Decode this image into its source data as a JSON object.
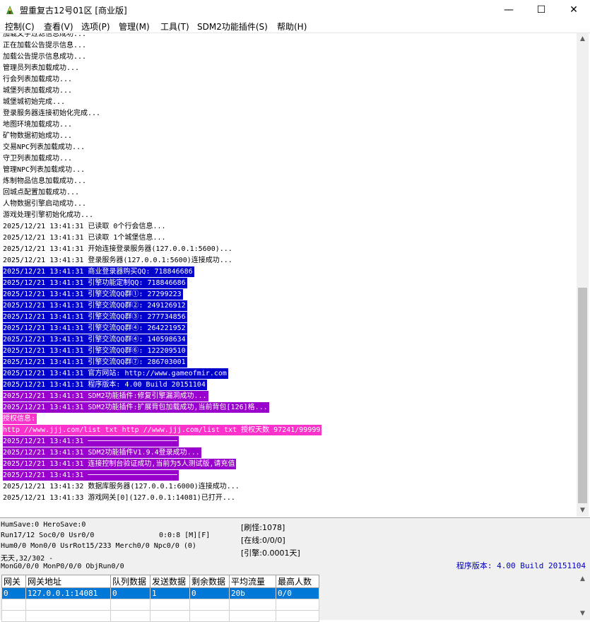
{
  "window": {
    "title": "盟重复古12号01区 [商业版]",
    "minimize": "—",
    "maximize": "☐",
    "close": "✕"
  },
  "menu": [
    "控制(C)",
    "查看(V)",
    "选项(P)",
    "管理(M)",
    "工具(T)",
    "SDM2功能插件(S)",
    "帮助(H)"
  ],
  "log": [
    {
      "text": "加载文字过滤信息成功...",
      "bg": "",
      "fg": "#000000"
    },
    {
      "text": "正在加载公告提示信息...",
      "bg": "",
      "fg": "#000000"
    },
    {
      "text": "加载公告提示信息成功...",
      "bg": "",
      "fg": "#000000"
    },
    {
      "text": "管理员列表加载成功...",
      "bg": "",
      "fg": "#000000"
    },
    {
      "text": "行会列表加载成功...",
      "bg": "",
      "fg": "#000000"
    },
    {
      "text": "城堡列表加载成功...",
      "bg": "",
      "fg": "#000000"
    },
    {
      "text": "城堡城初始完成...",
      "bg": "",
      "fg": "#000000"
    },
    {
      "text": "登录服务器连接初始化完成...",
      "bg": "",
      "fg": "#000000"
    },
    {
      "text": "地图环境加载成功...",
      "bg": "",
      "fg": "#000000"
    },
    {
      "text": "矿物数据初始成功...",
      "bg": "",
      "fg": "#000000"
    },
    {
      "text": "交易NPC列表加载成功...",
      "bg": "",
      "fg": "#000000"
    },
    {
      "text": "守卫列表加载成功...",
      "bg": "",
      "fg": "#000000"
    },
    {
      "text": "管理NPC列表加载成功...",
      "bg": "",
      "fg": "#000000"
    },
    {
      "text": "炼制物品信息加载成功...",
      "bg": "",
      "fg": "#000000"
    },
    {
      "text": "回城点配置加载成功...",
      "bg": "",
      "fg": "#000000"
    },
    {
      "text": "人物数据引擎启动成功...",
      "bg": "",
      "fg": "#000000"
    },
    {
      "text": "游戏处理引擎初始化成功...",
      "bg": "",
      "fg": "#000000"
    },
    {
      "text": "2025/12/21 13:41:31 已读取 0个行会信息...",
      "bg": "",
      "fg": "#000000"
    },
    {
      "text": "2025/12/21 13:41:31 已读取 1个城堡信息...",
      "bg": "",
      "fg": "#000000"
    },
    {
      "text": "2025/12/21 13:41:31 开始连接登录服务器(127.0.0.1:5600)...",
      "bg": "",
      "fg": "#000000"
    },
    {
      "text": "2025/12/21 13:41:31 登录服务器(127.0.0.1:5600)连接成功...",
      "bg": "",
      "fg": "#000000"
    },
    {
      "text": "2025/12/21 13:41:31 商业登录器购买QQ: 718846686",
      "bg": "#0000cc",
      "fg": "#ffffff"
    },
    {
      "text": "2025/12/21 13:41:31 引擎功能定制QQ: 718846686",
      "bg": "#0000cc",
      "fg": "#ffffff"
    },
    {
      "text": "2025/12/21 13:41:31 引擎交流QQ群①: 27299223",
      "bg": "#0000cc",
      "fg": "#ffffff"
    },
    {
      "text": "2025/12/21 13:41:31 引擎交流QQ群②: 249126912",
      "bg": "#0000cc",
      "fg": "#ffffff"
    },
    {
      "text": "2025/12/21 13:41:31 引擎交流QQ群③: 277734856",
      "bg": "#0000cc",
      "fg": "#ffffff"
    },
    {
      "text": "2025/12/21 13:41:31 引擎交流QQ群④: 264221952",
      "bg": "#0000cc",
      "fg": "#ffffff"
    },
    {
      "text": "2025/12/21 13:41:31 引擎交流QQ群④: 140598634",
      "bg": "#0000cc",
      "fg": "#ffffff"
    },
    {
      "text": "2025/12/21 13:41:31 引擎交流QQ群⑥: 122209510",
      "bg": "#0000cc",
      "fg": "#ffffff"
    },
    {
      "text": "2025/12/21 13:41:31 引擎交流QQ群⑦: 286703001",
      "bg": "#0000cc",
      "fg": "#ffffff"
    },
    {
      "text": "2025/12/21 13:41:31 官方网站: http://www.gameofmir.com",
      "bg": "#0000cc",
      "fg": "#ffffff"
    },
    {
      "text": "2025/12/21 13:41:31 程序版本: 4.00 Build 20151104",
      "bg": "#0000cc",
      "fg": "#ffffff"
    },
    {
      "text": "2025/12/21 13:41:31 SDM2功能插件:修复引擎漏洞成功...",
      "bg": "#9900cc",
      "fg": "#ffffff"
    },
    {
      "text": "2025/12/21 13:41:31 SDM2功能插件:扩展背包加载成功,当前背包[126]格...",
      "bg": "#9900cc",
      "fg": "#ffffff"
    },
    {
      "text": "授权信息:",
      "bg": "#ff33cc",
      "fg": "#ffffff"
    },
    {
      "text": "http //www.jjj.com/list txt http //www.jjj.com/list txt 授权天数 97241/99999",
      "bg": "#ff33cc",
      "fg": "#ffffff"
    },
    {
      "text": "2025/12/21 13:41:31 ─────────────────────",
      "bg": "#9900cc",
      "fg": "#ffffff"
    },
    {
      "text": "2025/12/21 13:41:31 SDM2功能插件V1.9.4登录成功...",
      "bg": "#9900cc",
      "fg": "#ffffff"
    },
    {
      "text": "2025/12/21 13:41:31 连接控制台验证成功,当前为5人测试版,请充值",
      "bg": "#9900cc",
      "fg": "#ffffff"
    },
    {
      "text": "2025/12/21 13:41:31 ─────────────────────",
      "bg": "#9900cc",
      "fg": "#ffffff"
    },
    {
      "text": "2025/12/21 13:41:32 数据库服务器(127.0.0.1:6000)连接成功...",
      "bg": "",
      "fg": "#000000"
    },
    {
      "text": "2025/12/21 13:41:33 游戏网关[0](127.0.0.1:14081)已打开...",
      "bg": "",
      "fg": "#000000"
    }
  ],
  "stats": {
    "line1": "HumSave:0 HeroSave:0",
    "line2": "Run17/12 Soc0/0 Usr0/0",
    "line2b": "0:0:8 [M][F]",
    "line3": "Hum0/0 Mon0/0 UsrRot15/233 Merch0/0 Npc0/0 (0)",
    "line4": "无天,32/302 -",
    "line5": "MonG0/0/0 MonP0/0/0 ObjRun0/0"
  },
  "right_stats": {
    "refresh": "[刷怪:1078]",
    "online": "[在线:0/0/0]",
    "engine": "[引擎:0.0001天]"
  },
  "program_version": "程序版本: 4.00 Build 20151104",
  "gate_table": {
    "headers": [
      "网关",
      "网关地址",
      "队列数据",
      "发送数据",
      "剩余数据",
      "平均流量",
      "最高人数"
    ],
    "rows": [
      [
        "0",
        "127.0.0.1:14081",
        "0",
        "1",
        "0",
        "20b",
        "0/0"
      ]
    ]
  }
}
